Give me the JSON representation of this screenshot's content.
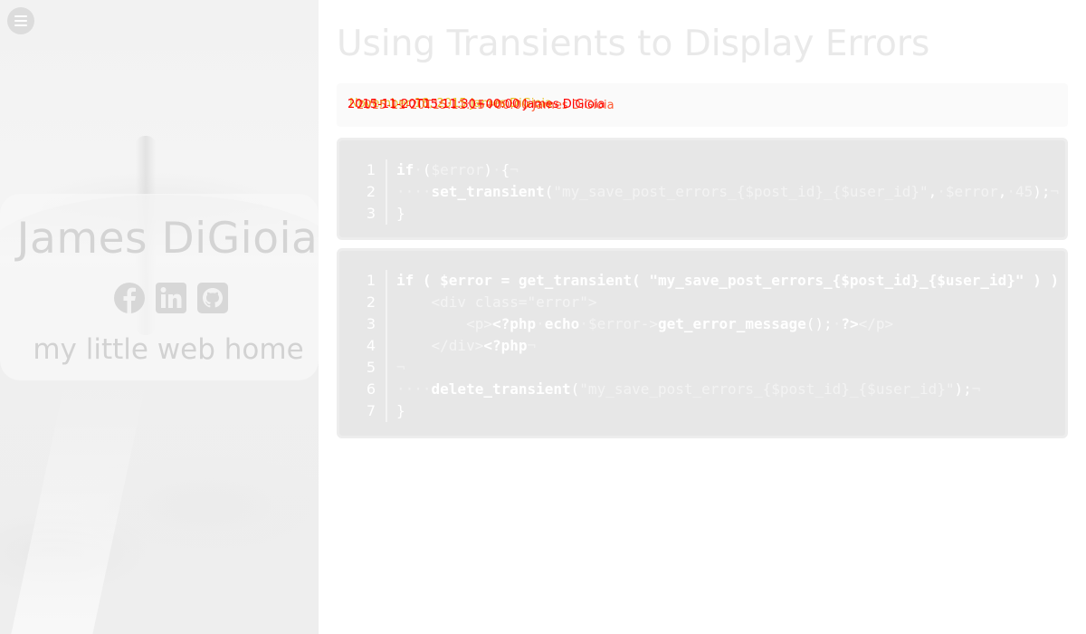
{
  "sidebar": {
    "menu_icon": "hamburger-menu-icon",
    "site_name": "James DiGioia",
    "tagline": "my little web home",
    "social": [
      {
        "name": "facebook",
        "icon": "facebook-icon"
      },
      {
        "name": "linkedin",
        "icon": "linkedin-icon"
      },
      {
        "name": "github",
        "icon": "github-icon"
      }
    ]
  },
  "post": {
    "title": "Using Transients to Display Errors",
    "meta_text": "2015-11-20T15:11:30+00:00 James DiGioia",
    "meta_text_2": "November 18, 2015 James DiGioia",
    "meta_text_3": "2015-11-20T15:11:15+00:00 James DiGioia"
  },
  "code_blocks": [
    {
      "lines": [
        {
          "num": "1",
          "tokens": [
            [
              "k",
              "if"
            ],
            [
              "w",
              "·"
            ],
            [
              "p",
              "("
            ],
            [
              "v",
              "$error"
            ],
            [
              "p",
              ")"
            ],
            [
              "w",
              "·"
            ],
            [
              "p",
              "{"
            ],
            [
              "w",
              "¬"
            ]
          ]
        },
        {
          "num": "2",
          "tokens": [
            [
              "w",
              "····"
            ],
            [
              "f",
              "set_transient"
            ],
            [
              "p",
              "("
            ],
            [
              "s",
              "\"my_save_post_errors_{$post_id}_{$user_id}\""
            ],
            [
              "p",
              ","
            ],
            [
              "w",
              "·"
            ],
            [
              "v",
              "$error"
            ],
            [
              "p",
              ","
            ],
            [
              "w",
              "·"
            ],
            [
              "s",
              "45"
            ],
            [
              "p",
              ");"
            ],
            [
              "w",
              "¬"
            ]
          ]
        },
        {
          "num": "3",
          "tokens": [
            [
              "p",
              "}"
            ]
          ]
        }
      ]
    },
    {
      "lines": [
        {
          "num": "1",
          "tokens": [
            [
              "k",
              "if ( $error = get_transient( \"my_save_post_errors_{$post_id}_{$user_id}\" ) ) {"
            ]
          ]
        },
        {
          "num": "2",
          "tokens": [
            [
              "h",
              "    <div class=\"error\">"
            ]
          ]
        },
        {
          "num": "3",
          "tokens": [
            [
              "h",
              "        <p>"
            ],
            [
              "k",
              "<?php"
            ],
            [
              "w",
              "·"
            ],
            [
              "k",
              "echo"
            ],
            [
              "w",
              "·"
            ],
            [
              "v",
              "$error->"
            ],
            [
              "f",
              "get_error_message"
            ],
            [
              "p",
              "();"
            ],
            [
              "w",
              "·"
            ],
            [
              "k",
              "?>"
            ],
            [
              "h",
              "</p>"
            ]
          ]
        },
        {
          "num": "4",
          "tokens": [
            [
              "h",
              "    </div>"
            ],
            [
              "k",
              "<?php"
            ],
            [
              "w",
              "¬"
            ]
          ]
        },
        {
          "num": "5",
          "tokens": [
            [
              "w",
              "¬"
            ]
          ]
        },
        {
          "num": "6",
          "tokens": [
            [
              "w",
              "····"
            ],
            [
              "f",
              "delete_transient"
            ],
            [
              "p",
              "("
            ],
            [
              "s",
              "\"my_save_post_errors_{$post_id}_{$user_id}\""
            ],
            [
              "p",
              ");"
            ],
            [
              "w",
              "¬"
            ]
          ]
        },
        {
          "num": "7",
          "tokens": [
            [
              "p",
              "}"
            ]
          ]
        }
      ]
    }
  ]
}
